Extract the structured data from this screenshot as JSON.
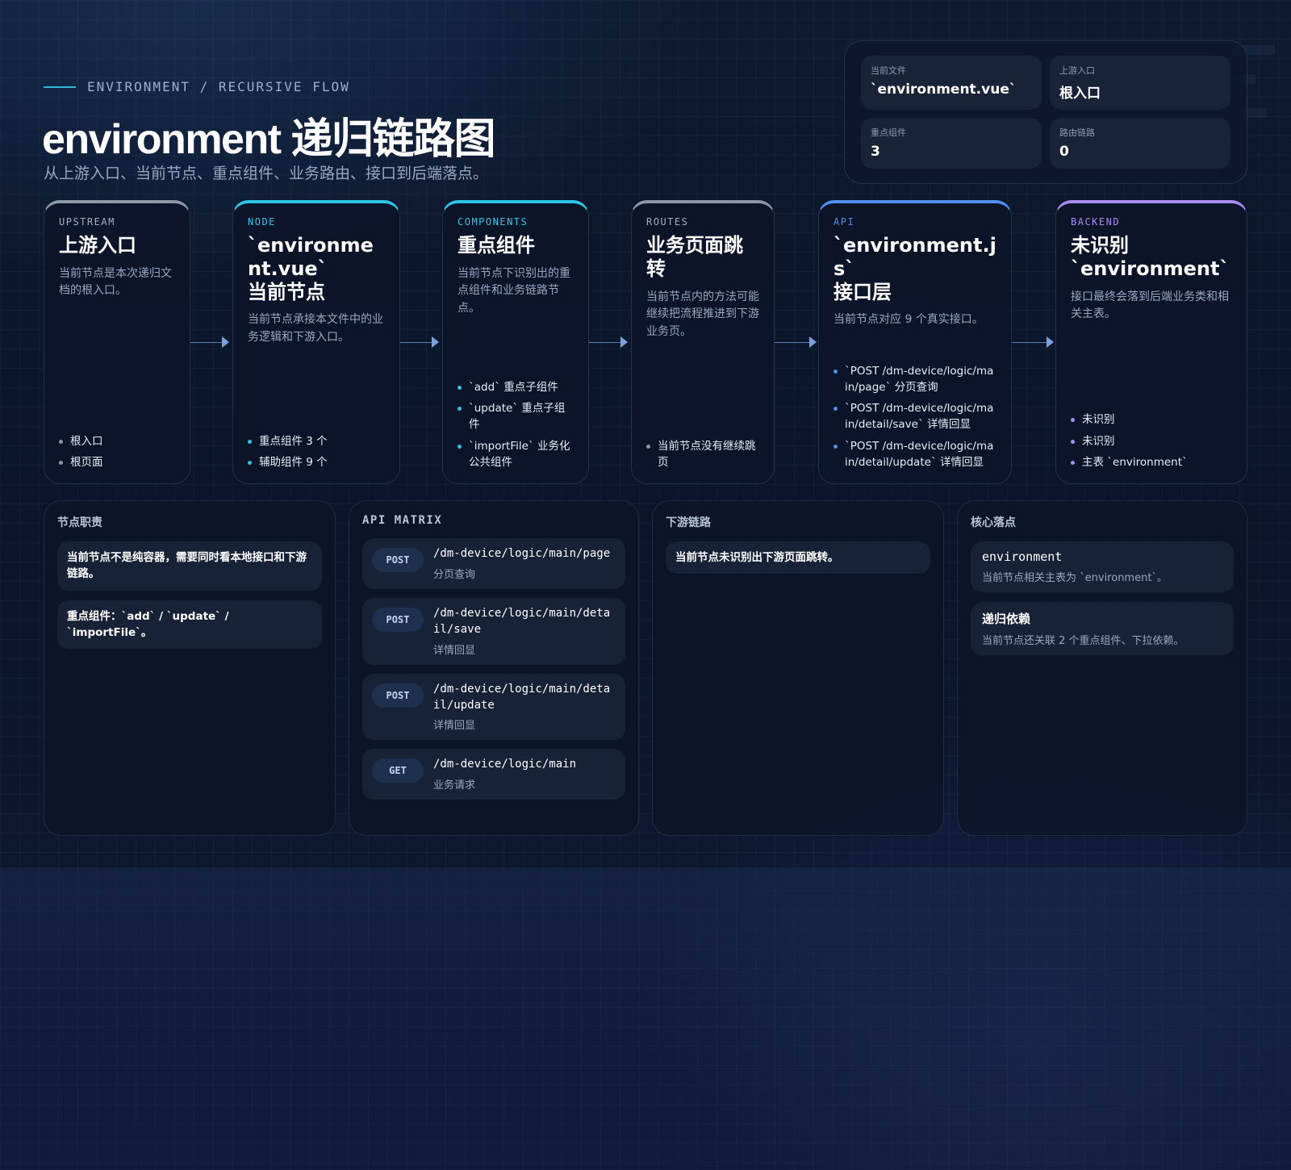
{
  "header": {
    "eyebrow": "ENVIRONMENT / RECURSIVE FLOW",
    "title": "environment 递归链路图",
    "subtitle": "从上游入口、当前节点、重点组件、业务路由、接口到后端落点。"
  },
  "stats": [
    {
      "label": "当前文件",
      "value": "`environment.vue`"
    },
    {
      "label": "上游入口",
      "value": "根入口"
    },
    {
      "label": "重点组件",
      "value": "3"
    },
    {
      "label": "路由链路",
      "value": "0"
    }
  ],
  "flow": [
    {
      "tag": "UPSTREAM",
      "title": "上游入口",
      "desc": "当前节点是本次递归文档的根入口。",
      "items": [
        "根入口",
        "根页面"
      ],
      "color": "#8c97a8"
    },
    {
      "tag": "NODE",
      "title": "`environment.vue`\n当前节点",
      "desc": "当前节点承接本文件中的业务逻辑和下游入口。",
      "items": [
        "重点组件 3 个",
        "辅助组件 9 个"
      ],
      "color": "#2fc6e6"
    },
    {
      "tag": "COMPONENTS",
      "title": "重点组件",
      "desc": "当前节点下识别出的重点组件和业务链路节点。",
      "items": [
        "`add` 重点子组件",
        "`update` 重点子组件",
        "`importFile` 业务化公共组件"
      ],
      "color": "#2fc6e6"
    },
    {
      "tag": "ROUTES",
      "title": "业务页面跳转",
      "desc": "当前节点内的方法可能继续把流程推进到下游业务页。",
      "items": [
        "当前节点没有继续跳页"
      ],
      "color": "#8c97a8"
    },
    {
      "tag": "API",
      "title": "`environment.js`\n接口层",
      "desc": "当前节点对应 9 个真实接口。",
      "items": [
        "`POST /dm-device/logic/main/page` 分页查询",
        "`POST /dm-device/logic/main/detail/save` 详情回显",
        "`POST /dm-device/logic/main/detail/update` 详情回显"
      ],
      "color": "#4f8ff0"
    },
    {
      "tag": "BACKEND",
      "title": "未识别\n`environment`",
      "desc": "接口最终会落到后端业务类和相关主表。",
      "items": [
        "未识别",
        "未识别",
        "主表 `environment`"
      ],
      "color": "#a98cf0"
    }
  ],
  "panels": {
    "duty": {
      "title": "节点职责",
      "notes": [
        "当前节点不是纯容器，需要同时看本地接口和下游链路。",
        "重点组件：`add` / `update` / `importFile`。"
      ]
    },
    "api": {
      "title": "API MATRIX",
      "rows": [
        {
          "method": "POST",
          "path": "/dm-device/logic/main/page",
          "desc": "分页查询"
        },
        {
          "method": "POST",
          "path": "/dm-device/logic/main/detail/save",
          "desc": "详情回显"
        },
        {
          "method": "POST",
          "path": "/dm-device/logic/main/detail/update",
          "desc": "详情回显"
        },
        {
          "method": "GET",
          "path": "/dm-device/logic/main",
          "desc": "业务请求"
        }
      ]
    },
    "downstream": {
      "title": "下游链路",
      "notes": [
        "当前节点未识别出下游页面跳转。"
      ]
    },
    "core": {
      "title": "核心落点",
      "items": [
        {
          "title": "environment",
          "desc": "当前节点相关主表为 `environment`。"
        },
        {
          "title": "递归依赖",
          "desc": "当前节点还关联 2 个重点组件、下拉依赖。"
        }
      ]
    }
  }
}
